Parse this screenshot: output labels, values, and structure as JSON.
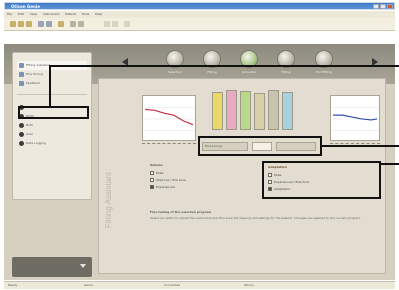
{
  "window": {
    "title": "Oticon Genie",
    "menu": [
      "File",
      "Edit",
      "View",
      "Instrument",
      "Patient",
      "Tools",
      "Help"
    ],
    "status": [
      "Ready",
      "Genie",
      "Connected",
      "Oticon"
    ]
  },
  "brand": {
    "logo": "oticon",
    "tagline": "PEOPLE FIRST"
  },
  "tabs": [
    {
      "label": "Selection",
      "icon": "selection-icon"
    },
    {
      "label": "Fitting",
      "icon": "fitting-icon"
    },
    {
      "label": "Acoustics",
      "icon": "acoustics-icon"
    },
    {
      "label": "Fitting",
      "icon": "fitting-icon"
    },
    {
      "label": "End Fitting",
      "icon": "end-fitting-icon"
    }
  ],
  "sidebar": {
    "top_items": [
      "Fitting Assistant",
      "Fine Tuning",
      "Feedback"
    ],
    "selected_index": 0,
    "bottom_items": [
      "Left",
      "Right",
      "Both",
      "Auto",
      "Data Logging"
    ]
  },
  "main": {
    "vertical_title": "Fitting Assistant",
    "progress_label": "Fine tuning",
    "progress_value": "",
    "left_options": {
      "heading": "Volume",
      "items": [
        "Mute",
        "Start low / fine tune",
        "Experienced"
      ],
      "checked": [
        false,
        false,
        true
      ]
    },
    "right_options": {
      "heading": "Adaptation",
      "items": [
        "Mute",
        "Experienced / first time",
        "Adaptation"
      ],
      "checked": [
        false,
        false,
        true
      ]
    },
    "description_heading": "Fine tuning of the selected program",
    "description": "Select an option to adjust the instrument and fine tune the hearing aid settings for the patient. Changes are applied to the current program."
  },
  "colors": {
    "accent": "#c9b06a",
    "bars": [
      "#e8d96a",
      "#e8a9c2",
      "#b9d98a",
      "#d9cfa8",
      "#c9c4ae",
      "#a9d2e0"
    ],
    "curve_left": "#c03040",
    "curve_right": "#3050b0"
  }
}
